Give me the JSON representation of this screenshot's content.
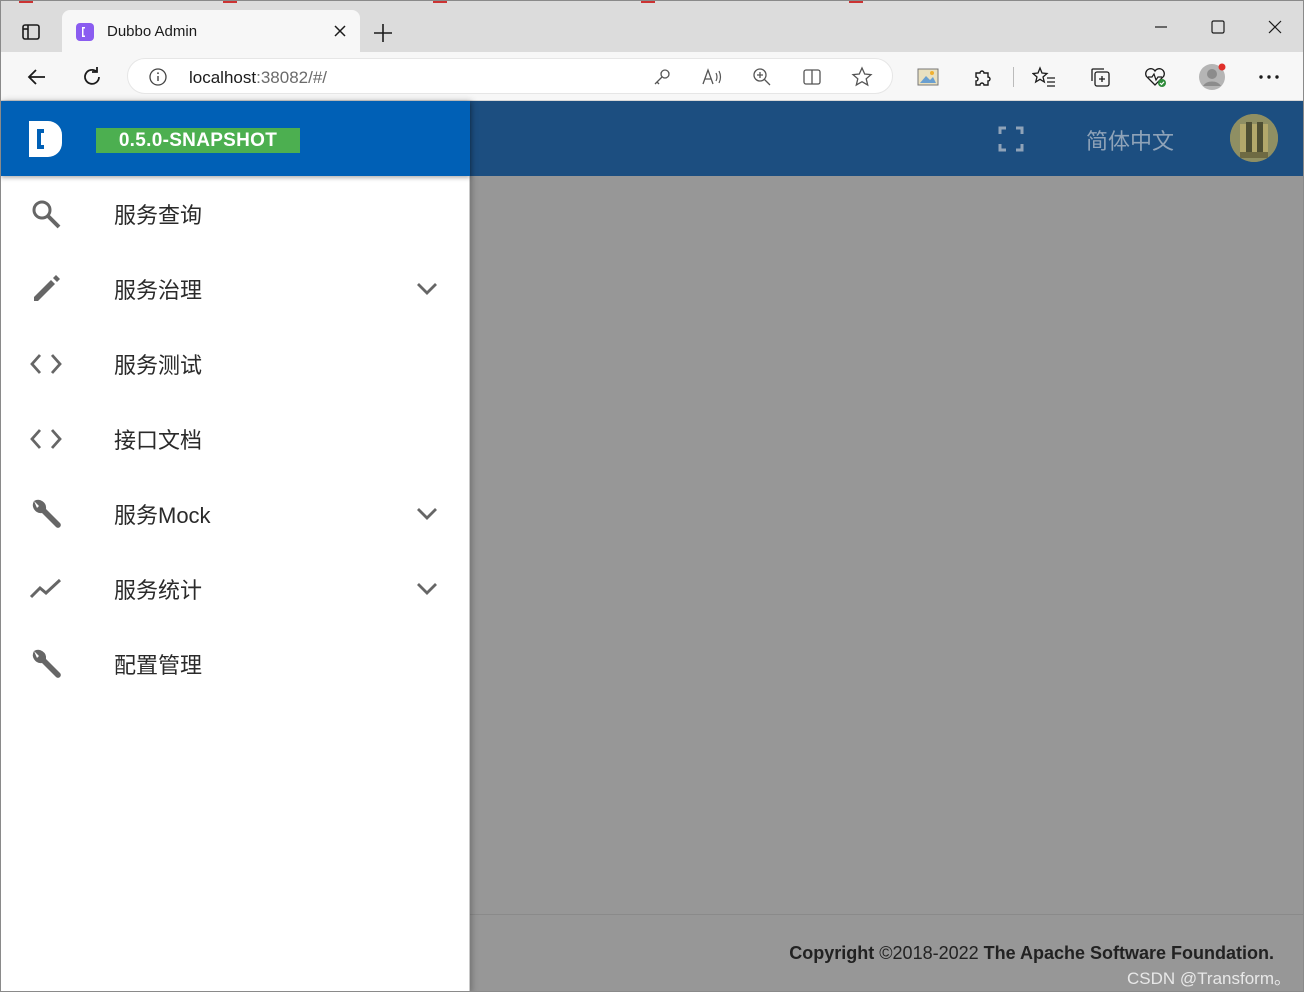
{
  "browser": {
    "tab_title": "Dubbo Admin",
    "url_host": "localhost",
    "url_rest": ":38082/#/"
  },
  "app": {
    "version": "0.5.0-SNAPSHOT",
    "language": "简体中文",
    "nav": [
      {
        "label": "服务查询",
        "icon": "search-icon",
        "expandable": false
      },
      {
        "label": "服务治理",
        "icon": "pencil-icon",
        "expandable": true
      },
      {
        "label": "服务测试",
        "icon": "code-icon",
        "expandable": false
      },
      {
        "label": "接口文档",
        "icon": "code-icon",
        "expandable": false
      },
      {
        "label": "服务Mock",
        "icon": "wrench-icon",
        "expandable": true
      },
      {
        "label": "服务统计",
        "icon": "trending-icon",
        "expandable": true
      },
      {
        "label": "配置管理",
        "icon": "wrench-icon",
        "expandable": false
      }
    ]
  },
  "footer": {
    "copyright_prefix": "Copyright",
    "copyright_years": " ©2018-2022 ",
    "org": "The Apache Software Foundation.",
    "watermark": "CSDN @Transform。"
  },
  "colors": {
    "drawer_header": "#0060b6",
    "appbar": "#1c4e80",
    "version_badge": "#4caf50",
    "overlay": "#979797"
  }
}
